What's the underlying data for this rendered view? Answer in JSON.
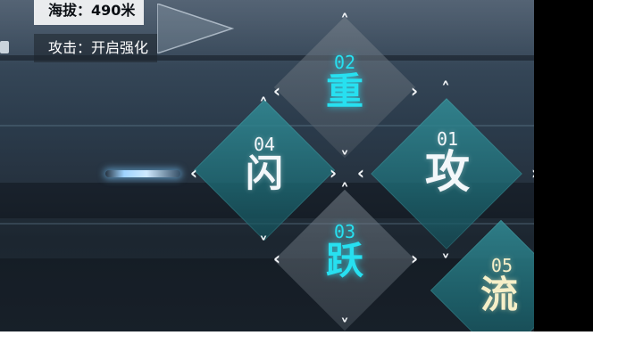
{
  "hud": {
    "altitude_label": "海拔：",
    "altitude_value": "490米",
    "attack_status": "攻击：开启强化"
  },
  "skills": [
    {
      "num": "01",
      "char": "攻",
      "color": "white"
    },
    {
      "num": "02",
      "char": "重",
      "color": "cyan"
    },
    {
      "num": "03",
      "char": "跃",
      "color": "cyan"
    },
    {
      "num": "04",
      "char": "闪",
      "color": "white"
    },
    {
      "num": "05",
      "char": "流",
      "color": "cream"
    }
  ],
  "colors": {
    "cyan": "#27e0f0",
    "teal_tile": "#2a8e98",
    "cream": "#f6efc8"
  },
  "icons": [
    "chevron-up-icon",
    "chevron-down-icon",
    "chevron-left-icon",
    "chevron-right-icon",
    "pointer-arrow-icon"
  ]
}
